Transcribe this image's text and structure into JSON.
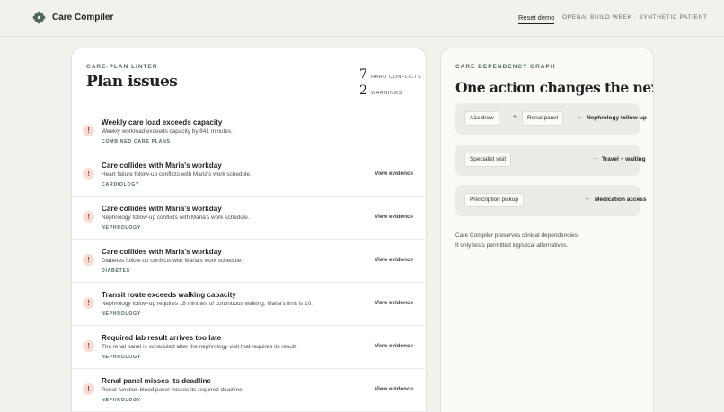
{
  "header": {
    "brand": "Care Compiler",
    "reset_label": "Reset demo",
    "event_label": "OPENAI BUILD WEEK · SYNTHETIC PATIENT"
  },
  "linter": {
    "eyebrow": "CARE-PLAN LINTER",
    "title": "Plan issues",
    "stats": [
      {
        "value": "7",
        "label": "HARD CONFLICTS"
      },
      {
        "value": "2",
        "label": "WARNINGS"
      }
    ],
    "issues": [
      {
        "title": "Weekly care load exceeds capacity",
        "desc": "Weekly workload exceeds capacity by 841 minutes.",
        "tag": "COMBINED CARE PLANS",
        "action": ""
      },
      {
        "title": "Care collides with Maria's workday",
        "desc": "Heart failure follow-up conflicts with Maria's work schedule.",
        "tag": "CARDIOLOGY",
        "action": "View evidence"
      },
      {
        "title": "Care collides with Maria's workday",
        "desc": "Nephrology follow-up conflicts with Maria's work schedule.",
        "tag": "NEPHROLOGY",
        "action": "View evidence"
      },
      {
        "title": "Care collides with Maria's workday",
        "desc": "Diabetes follow-up conflicts with Maria's work schedule.",
        "tag": "DIABETES",
        "action": "View evidence"
      },
      {
        "title": "Transit route exceeds walking capacity",
        "desc": "Nephrology follow-up requires 18 minutes of continuous walking; Maria's limit is 10.",
        "tag": "NEPHROLOGY",
        "action": "View evidence"
      },
      {
        "title": "Required lab result arrives too late",
        "desc": "The renal panel is scheduled after the nephrology visit that requires its result.",
        "tag": "NEPHROLOGY",
        "action": "View evidence"
      },
      {
        "title": "Renal panel misses its deadline",
        "desc": "Renal function blood panel misses its required deadline.",
        "tag": "NEPHROLOGY",
        "action": "View evidence"
      }
    ],
    "issue_icon": "!"
  },
  "graph": {
    "eyebrow": "CARE DEPENDENCY GRAPH",
    "title": "One action changes the next.",
    "plus": "+",
    "arrow": "→",
    "rows": [
      {
        "chip1": "A1c draw",
        "chip2": "Renal panel",
        "target": "Nephrology follow-up"
      },
      {
        "chip1": "Specialist visit",
        "target": "Travel + waiting"
      },
      {
        "chip1": "Prescription pickup",
        "target": "Medication access"
      }
    ],
    "note_line1": "Care Compiler preserves clinical dependencies.",
    "note_line2": "It only tests permitted logistical alternatives."
  },
  "colors": {
    "accent": "#4e6a58",
    "warning_bg": "#f6ddd6",
    "warning_fg": "#b04a36",
    "page_bg": "#f2f1ec"
  },
  "icons": {
    "brand": "flower-logo-icon",
    "issue": "alert-icon",
    "arrow": "arrow-right-icon"
  }
}
